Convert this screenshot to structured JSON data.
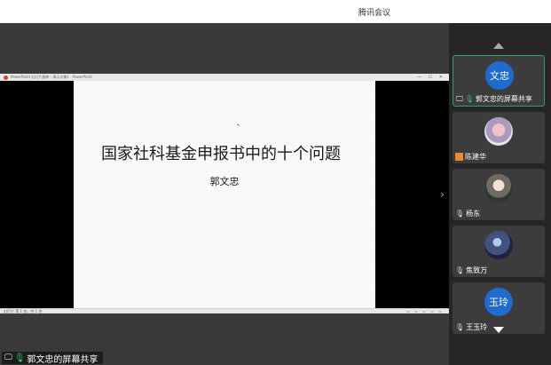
{
  "app": {
    "window_title": "腾讯会议"
  },
  "share": {
    "window_title": "PowerPoint 幻灯片放映 - 演示文稿1 - PowerPoint",
    "window_controls": "— ☐ ✕",
    "slide": {
      "mark": "、",
      "title": "国家社科基金申报书中的十个问题",
      "author": "郭文忠"
    },
    "status_text": "幻灯片 第 1 张，共 1 张",
    "status_icons": "▭ ▭ ▭ ▭ ▭",
    "presenter_label": "郭文忠的屏幕共享",
    "next_arrow": "›"
  },
  "participants": [
    {
      "avatar_text": "文忠",
      "name": "郭文忠的屏幕共享",
      "status": "sharing-mic-on",
      "active": true
    },
    {
      "avatar_text": "",
      "name": "陈建华",
      "status": "video-off"
    },
    {
      "avatar_text": "",
      "name": "杨东",
      "status": "mic-off"
    },
    {
      "avatar_text": "",
      "name": "焦致万",
      "status": "mic-off"
    },
    {
      "avatar_text": "玉玲",
      "name": "王玉玲",
      "status": "mic-off"
    }
  ],
  "colors": {
    "accent": "#2e9e74",
    "avatar_blue": "#1f6bd0",
    "mic_on": "#3bc76a",
    "video_off": "#f08a24"
  }
}
